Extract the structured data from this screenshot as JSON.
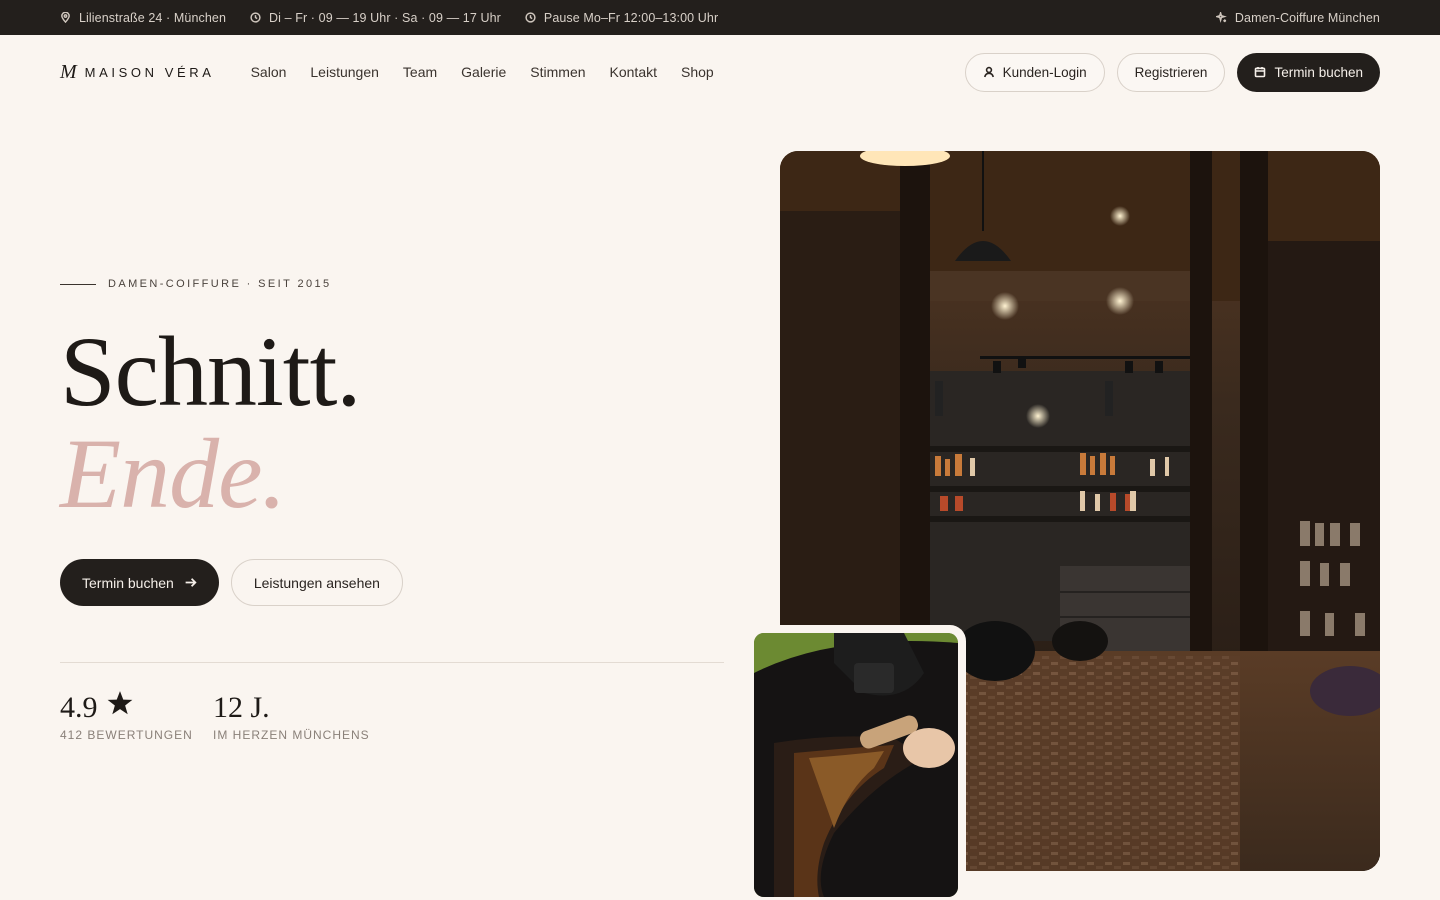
{
  "topbar": {
    "address": "Lilienstraße 24 · München",
    "hours": "Di – Fr · 09 — 19 Uhr · Sa · 09 — 17 Uhr",
    "pause": "Pause Mo–Fr 12:00–13:00 Uhr",
    "tagline": "Damen-Coiffure München"
  },
  "nav": {
    "logo_mark": "M",
    "logo_text": "MAISON VÉRA",
    "links": [
      "Salon",
      "Leistungen",
      "Team",
      "Galerie",
      "Stimmen",
      "Kontakt",
      "Shop"
    ],
    "login": "Kunden-Login",
    "register": "Registrieren",
    "book": "Termin buchen"
  },
  "hero": {
    "eyebrow": "DAMEN-COIFFURE · SEIT 2015",
    "headline_1": "Schnitt.",
    "headline_2": "Ende.",
    "cta_primary": "Termin buchen",
    "cta_secondary": "Leistungen ansehen"
  },
  "stats": [
    {
      "value": "4.9",
      "label": "412 BEWERTUNGEN"
    },
    {
      "value": "12 J.",
      "label": "IM HERZEN MÜNCHENS"
    }
  ],
  "icons": {
    "address": "map-pin-icon",
    "hours": "clock-icon",
    "pause": "clock-icon",
    "tagline": "sparkle-icon",
    "login": "user-icon",
    "book": "calendar-icon",
    "cta": "arrow-right-icon",
    "rating": "star-icon"
  },
  "colors": {
    "topbar_bg": "#231f1c",
    "page_bg": "#faf5f0",
    "accent_pink": "#d9b2ac",
    "dark": "#231f1c"
  }
}
